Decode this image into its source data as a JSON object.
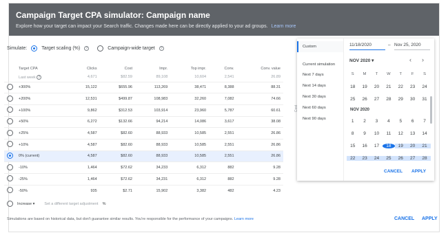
{
  "header": {
    "title": "Campaign Target CPA simulator: Campaign name",
    "subtitle": "Explore how your target can impact your Search traffic. Changes made here can be directly applied to your ad groups.",
    "learn_more": "Learn more"
  },
  "simulate": {
    "label": "Simulate:",
    "option1": "Target scaling (%)",
    "option2": "Campaign-wide target"
  },
  "table": {
    "headers": [
      "Target CPA",
      "Clicks",
      "Cost",
      "Impr.",
      "Top impr.",
      "Conv.",
      "Conv. value"
    ],
    "last_week": {
      "label": "Last week",
      "values": [
        "4,671",
        "$82.59",
        "89,108",
        "10,604",
        "2,541",
        "26.89"
      ]
    },
    "rows": [
      {
        "label": "+300%",
        "values": [
          "15,122",
          "$655.96",
          "113,269",
          "38,471",
          "8,388",
          "88.31"
        ]
      },
      {
        "label": "+200%",
        "values": [
          "12,531",
          "$499.87",
          "108,983",
          "32,260",
          "7,082",
          "74.66"
        ]
      },
      {
        "label": "+100%",
        "values": [
          "9,862",
          "$312.53",
          "103,914",
          "23,960",
          "5,787",
          "60.61"
        ]
      },
      {
        "label": "+50%",
        "values": [
          "6,272",
          "$132.66",
          "94,214",
          "14,086",
          "3,617",
          "38.08"
        ]
      },
      {
        "label": "+25%",
        "values": [
          "4,587",
          "$82.60",
          "88,933",
          "10,585",
          "2,551",
          "26.86"
        ]
      },
      {
        "label": "+10%",
        "values": [
          "4,587",
          "$82.60",
          "88,933",
          "10,585",
          "2,551",
          "26.86"
        ]
      },
      {
        "label": "0% (current)",
        "values": [
          "4,587",
          "$82.60",
          "88,933",
          "10,585",
          "2,551",
          "26.86"
        ]
      },
      {
        "label": "-10%",
        "values": [
          "1,464",
          "$72.62",
          "34,233",
          "6,312",
          "882",
          "9.28"
        ]
      },
      {
        "label": "-25%",
        "values": [
          "1,464",
          "$72.62",
          "34,231",
          "6,312",
          "882",
          "9.28"
        ]
      },
      {
        "label": "-50%",
        "values": [
          "935",
          "$2.71",
          "15,902",
          "3,382",
          "482",
          "4.23"
        ]
      }
    ],
    "adjust": {
      "select": "Increase",
      "placeholder": "Set a different target adjustment",
      "unit": "%"
    }
  },
  "footer": {
    "note": "Simulations are based on historical data, but don't guarantee similar results. You're responsible for the performance of your campaigns.",
    "learn_more": "Learn more",
    "cancel": "CANCEL",
    "apply": "APPLY"
  },
  "picker": {
    "presets": [
      "Custom",
      "Current simulation",
      "Next 7 days",
      "Next 14 days",
      "Next 30 days",
      "Next 60 days",
      "Next 90 days"
    ],
    "start": "11/18/2020",
    "dash": "–",
    "end": "Nov 25, 2020",
    "month_select": "NOV 2020",
    "prev": "‹",
    "next": "›",
    "dow": [
      "S",
      "M",
      "T",
      "W",
      "T",
      "F",
      "S"
    ],
    "oct_row1": [
      "18",
      "19",
      "20",
      "21",
      "22",
      "23",
      "24"
    ],
    "oct_row2": [
      "25",
      "26",
      "27",
      "28",
      "29",
      "30",
      "31"
    ],
    "month_label": "NOV 2020",
    "nov_rows": [
      [
        "1",
        "2",
        "3",
        "4",
        "5",
        "6",
        "7"
      ],
      [
        "8",
        "9",
        "10",
        "11",
        "12",
        "13",
        "14"
      ],
      [
        "15",
        "16",
        "17",
        "18",
        "19",
        "20",
        "21"
      ],
      [
        "22",
        "23",
        "24",
        "25",
        "26",
        "27",
        "28"
      ]
    ],
    "cancel": "CANCEL",
    "apply": "APPLY"
  },
  "side_label": "Cost",
  "colors": {
    "header_bg": "#5f6368",
    "accent": "#1a73e8",
    "selected_row": "#e8f0fe",
    "range": "#d2e3fc"
  }
}
